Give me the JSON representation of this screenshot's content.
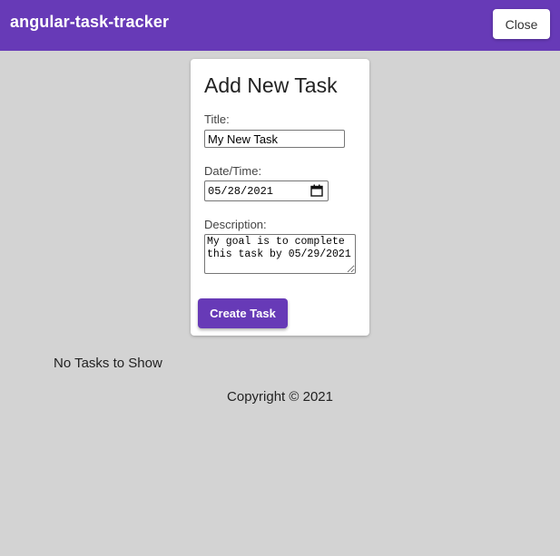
{
  "header": {
    "app_title": "angular-task-tracker",
    "close_label": "Close"
  },
  "form": {
    "heading": "Add New Task",
    "title_label": "Title:",
    "title_value": "My New Task",
    "date_label": "Date/Time:",
    "date_value": "05/28/2021",
    "description_label": "Description:",
    "description_value": "My goal is to complete this task by 05/29/2021",
    "submit_label": "Create Task"
  },
  "tasks": {
    "empty_message": "No Tasks to Show"
  },
  "footer": {
    "copyright": "Copyright © 2021"
  },
  "colors": {
    "primary": "#673ab7",
    "background": "#d3d3d3"
  }
}
